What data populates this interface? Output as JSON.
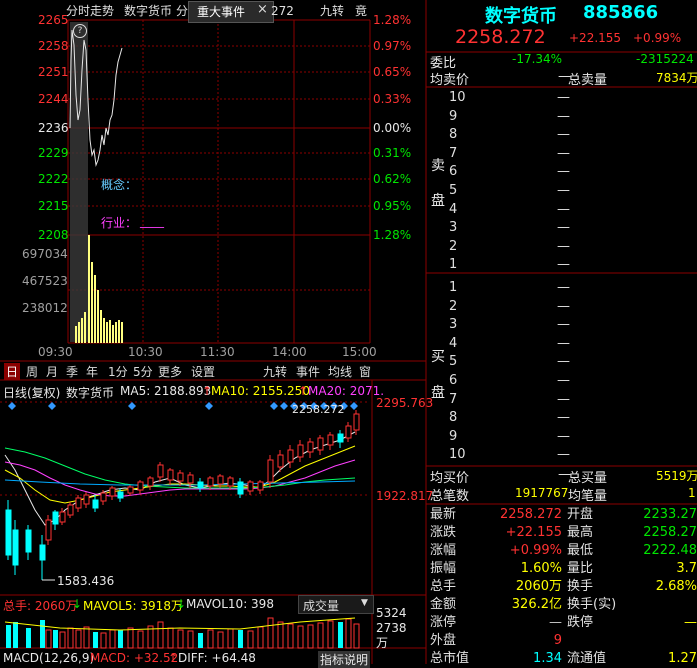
{
  "colors": {
    "up": "#ff3232",
    "down": "#00e600",
    "grid": "#8b0000",
    "accent": "#00ffff"
  },
  "top_tabs": {
    "tab1": "分时走势",
    "tab2": "数字货币",
    "tab3": "分",
    "tab4": "重大事件",
    "tab4_close": "×",
    "tab5": "272",
    "tab6": "九转",
    "tab7": "竟"
  },
  "intraday": {
    "price_ticks": [
      "2265",
      "2258",
      "2251",
      "2244",
      "2236",
      "2229",
      "2222",
      "2215",
      "2208"
    ],
    "pct_ticks": [
      "1.28%",
      "0.97%",
      "0.65%",
      "0.33%",
      "0.00%",
      "0.31%",
      "0.62%",
      "0.95%",
      "1.28%"
    ],
    "vol_ticks": [
      "697034",
      "467523",
      "238012"
    ],
    "time_ticks": [
      "09:30",
      "10:30",
      "11:30",
      "14:00",
      "15:00"
    ],
    "concept_label": "概念：",
    "industry_label": "行业：",
    "industry_value": "____",
    "help_icon": "?"
  },
  "kline_tabs": [
    "日",
    "周",
    "月",
    "季",
    "年",
    "1分",
    "5分",
    "更多",
    "设置"
  ],
  "kline_tabs_right": [
    "九转",
    "事件",
    "均线",
    "窗"
  ],
  "kline": {
    "title": "日线(复权)",
    "name": "数字货币",
    "ma5": "MA5: 2188.893",
    "ma5_arrow": "↑",
    "ma10": "MA10: 2155.250",
    "ma10_arrow": "↑",
    "ma20": "MA20: 2071.",
    "high_label": "2295.763",
    "mid_label": "1922.817",
    "low_label": "1583.436",
    "last_label": "2258.272"
  },
  "volume": {
    "label1": "总手: 2060万",
    "arrow1": "↓",
    "label2": "MAVOL5: 3918万",
    "arrow2": "↓",
    "label3": "MAVOL10: 398",
    "select": "成交量",
    "ticks": [
      "5324",
      "2738"
    ],
    "unit": "万"
  },
  "macd": {
    "label": "MACD(12,26,9)",
    "macd": "MACD: +32.52",
    "arrow": "↑",
    "diff": "DIFF: +64.48",
    "link": "指标说明"
  },
  "quote": {
    "name": "数字货币",
    "code": "885866",
    "price": "2258.272",
    "change": "+22.155",
    "pct": "+0.99%",
    "weibi_label": "委比",
    "weibi_value": "-17.34%",
    "weicha_value": "-2315224",
    "avg_sell_label": "均卖价",
    "avg_sell_value": "—",
    "total_sell_label": "总卖量",
    "total_sell_value": "7834万",
    "sell_side_label": [
      "卖",
      "盘"
    ],
    "buy_side_label": [
      "买",
      "盘"
    ],
    "sell_levels": [
      "10",
      "9",
      "8",
      "7",
      "6",
      "5",
      "4",
      "3",
      "2",
      "1"
    ],
    "buy_levels": [
      "1",
      "2",
      "3",
      "4",
      "5",
      "6",
      "7",
      "8",
      "9",
      "10"
    ],
    "dash": "—",
    "avg_buy_label": "均买价",
    "avg_buy_value": "—",
    "total_buy_label": "总买量",
    "total_buy_value": "5519万",
    "total_orders_label": "总笔数",
    "total_orders_value": "1917767",
    "avg_orders_label": "均笔量",
    "avg_orders_value": "1"
  },
  "stats": [
    {
      "l1": "最新",
      "v1": "2258.272",
      "c1": "red",
      "l2": "开盘",
      "v2": "2233.27"
    },
    {
      "l1": "涨跌",
      "v1": "+22.155",
      "c1": "red",
      "l2": "最高",
      "v2": "2258.27"
    },
    {
      "l1": "涨幅",
      "v1": "+0.99%",
      "c1": "red",
      "l2": "最低",
      "v2": "2222.48"
    },
    {
      "l1": "振幅",
      "v1": "1.60%",
      "c1": "yellow",
      "l2": "量比",
      "v2": "3.7"
    },
    {
      "l1": "总手",
      "v1": "2060万",
      "c1": "yellow",
      "l2": "换手",
      "v2": "2.68%"
    },
    {
      "l1": "金额",
      "v1": "326.2亿",
      "c1": "yellow",
      "l2": "换手(实)",
      "v2": ""
    },
    {
      "l1": "涨停",
      "v1": "—",
      "c1": "gray",
      "l2": "跌停",
      "v2": "—"
    },
    {
      "l1": "外盘",
      "v1": "9",
      "c1": "red",
      "l2": "",
      "v2": ""
    },
    {
      "l1": "总市值",
      "v1": "1.34",
      "c1": "cyan",
      "l2": "流通值",
      "v2": "1.27"
    }
  ]
}
